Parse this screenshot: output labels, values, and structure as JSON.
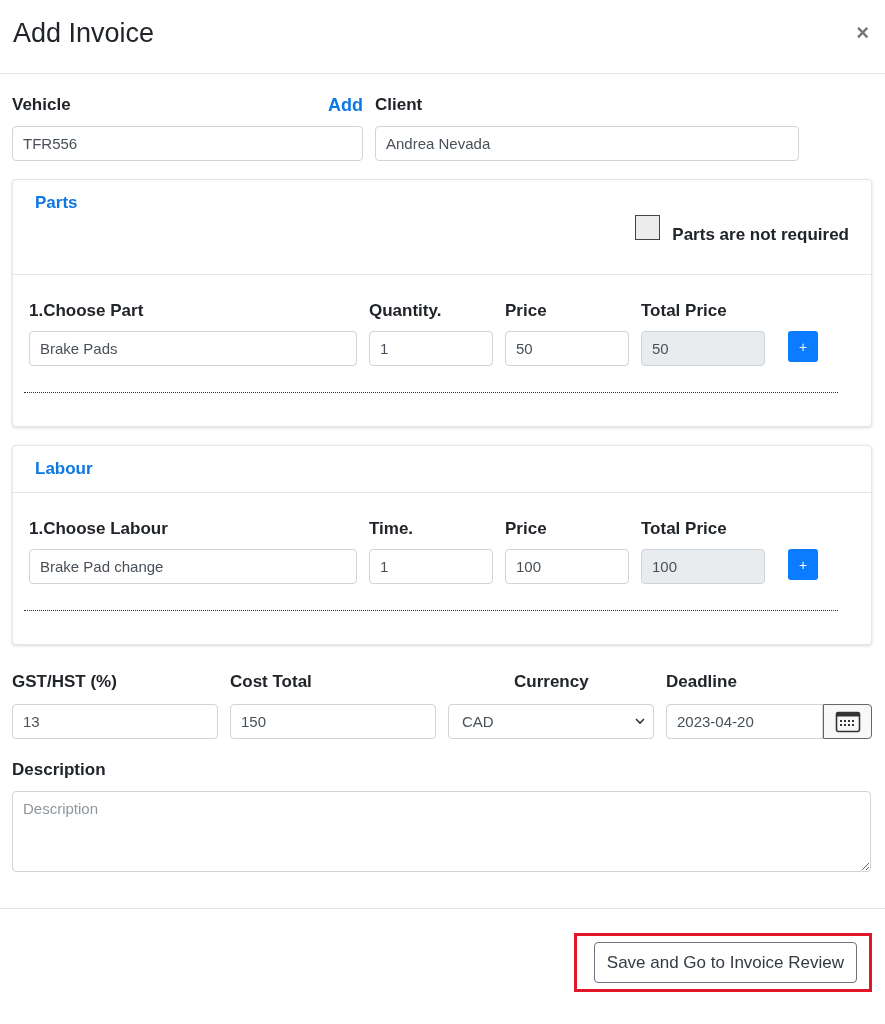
{
  "dialog": {
    "title": "Add Invoice",
    "close": "×"
  },
  "vehicle": {
    "label": "Vehicle",
    "add_link": "Add",
    "value": "TFR556"
  },
  "client": {
    "label": "Client",
    "value": "Andrea Nevada"
  },
  "sections": [
    {
      "title": "Parts",
      "not_required": {
        "label": "Parts are not required",
        "checked": false
      },
      "columns": [
        "1.Choose Part",
        "Quantity.",
        "Price",
        "Total Price"
      ],
      "fields": [
        {
          "value": "Brake Pads",
          "disabled": false
        },
        {
          "value": "1",
          "disabled": false
        },
        {
          "value": "50",
          "disabled": false
        },
        {
          "value": "50",
          "disabled": true
        }
      ],
      "add_button": "+"
    },
    {
      "title": "Labour",
      "columns": [
        "1.Choose Labour",
        "Time.",
        "Price",
        "Total Price"
      ],
      "fields": [
        {
          "value": "Brake Pad change",
          "disabled": false
        },
        {
          "value": "1",
          "disabled": false
        },
        {
          "value": "100",
          "disabled": false
        },
        {
          "value": "100",
          "disabled": true
        }
      ],
      "add_button": "+"
    }
  ],
  "summary": [
    {
      "label": "GST/HST (%)",
      "kind": "text",
      "value": "13"
    },
    {
      "label": "Cost Total",
      "kind": "text",
      "value": "150"
    },
    {
      "label": "Currency",
      "kind": "select",
      "value": "CAD"
    },
    {
      "label": "Deadline",
      "kind": "date",
      "value": "2023-04-20"
    }
  ],
  "description": {
    "label": "Description",
    "placeholder": "Description"
  },
  "footer": {
    "button": {
      "label": "Save and Go to Invoice Review",
      "highlighted": true
    }
  }
}
